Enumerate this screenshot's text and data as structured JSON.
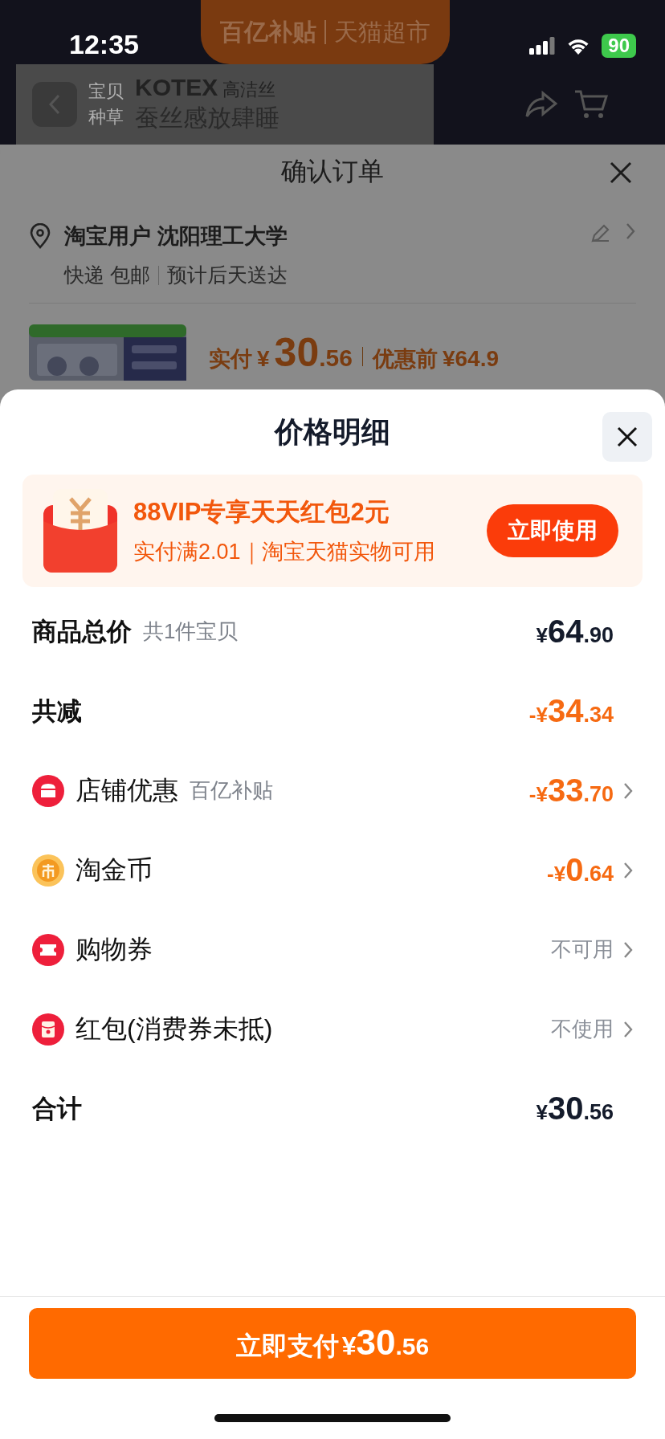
{
  "status_bar": {
    "time": "12:35",
    "battery": "90"
  },
  "background_page": {
    "banner": [
      "百亿补贴",
      "天猫超市"
    ],
    "brand": "KOTEX",
    "brand_cn": "高洁丝",
    "tabs": [
      "宝贝",
      "种草"
    ],
    "headline": "蚕丝感放肆睡"
  },
  "order_sheet": {
    "title": "确认订单",
    "address": "淘宝用户 沈阳理工大学",
    "delivery": [
      "快递 包邮",
      "预计后天送达"
    ],
    "paid_label": "实付",
    "paid_amount": "¥30.56",
    "before_label": "优惠前",
    "before_amount": "¥64.9"
  },
  "price_sheet": {
    "title": "价格明细",
    "promo": {
      "title": "88VIP专享天天红包2元",
      "subtitle": "实付满2.01｜淘宝天猫实物可用",
      "button": "立即使用"
    },
    "rows": [
      {
        "kind": "heading",
        "label": "商品总价",
        "note": "共1件宝贝",
        "amount": "¥64.90",
        "discount": false,
        "chevron": false
      },
      {
        "kind": "heading",
        "label": "共减",
        "amount": "-¥34.34",
        "discount": true,
        "chevron": false
      },
      {
        "kind": "shop",
        "label": "店铺优惠",
        "note": "百亿补贴",
        "amount": "-¥33.70",
        "discount": true,
        "chevron": true
      },
      {
        "kind": "coin",
        "label": "淘金币",
        "amount": "-¥0.64",
        "discount": true,
        "chevron": true
      },
      {
        "kind": "coupon",
        "label": "购物券",
        "status": "不可用",
        "chevron": true
      },
      {
        "kind": "envelope",
        "label": "红包(消费券未抵)",
        "status": "不使用",
        "chevron": true
      },
      {
        "kind": "heading",
        "label": "合计",
        "amount": "¥30.56",
        "discount": false,
        "chevron": false
      }
    ],
    "pay_button": {
      "label": "立即支付",
      "amount": "¥30.56"
    }
  }
}
